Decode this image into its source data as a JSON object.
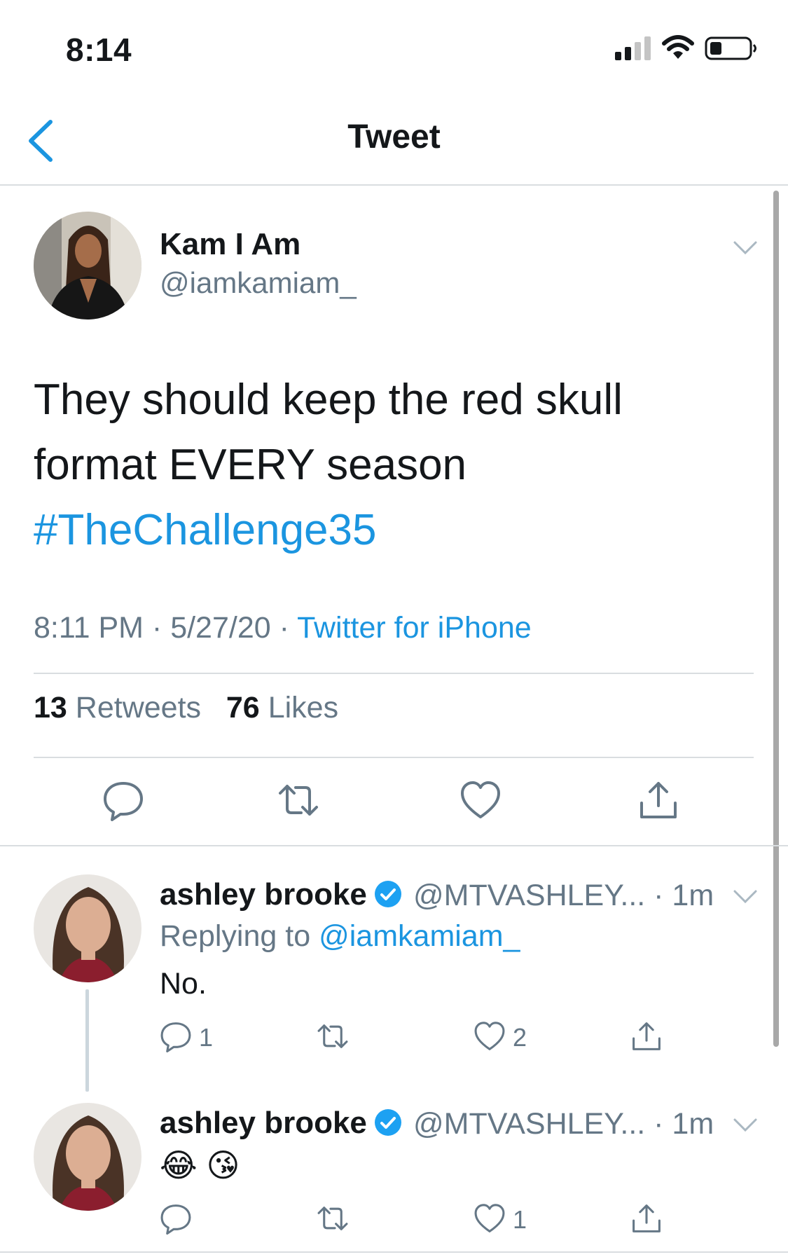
{
  "status_bar": {
    "time": "8:14"
  },
  "nav": {
    "title": "Tweet"
  },
  "tweet": {
    "author_name": "Kam I Am",
    "author_handle": "@iamkamiam_",
    "text_line1": "They should keep the red skull",
    "text_line2": "format EVERY season",
    "hashtag": "#TheChallenge35",
    "time": "8:11 PM",
    "date": "5/27/20",
    "separator": "·",
    "source": "Twitter for iPhone",
    "retweets_count": "13",
    "retweets_label": "Retweets",
    "likes_count": "76",
    "likes_label": "Likes"
  },
  "replies": [
    {
      "author_name": "ashley brooke",
      "handle_time": "@MTVASHLEY... · 1m",
      "replying_prefix": "Replying to",
      "replying_to": "@iamkamiam_",
      "text": "No.",
      "reply_count": "1",
      "like_count": "2"
    },
    {
      "author_name": "ashley brooke",
      "handle_time": "@MTVASHLEY... · 1m",
      "emojis": "😂 😘",
      "like_count": "1"
    }
  ],
  "colors": {
    "link": "#1b95e0",
    "secondary": "#657786",
    "icon": "#657786"
  }
}
